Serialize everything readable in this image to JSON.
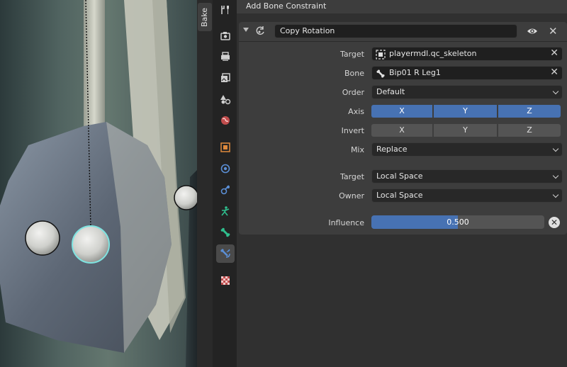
{
  "viewport": {
    "n_panel_tab": "Bake"
  },
  "properties_tabs": [
    {
      "name": "tool",
      "icon": "tool-icon"
    },
    {
      "name": "render",
      "icon": "render-icon"
    },
    {
      "name": "output",
      "icon": "output-icon"
    },
    {
      "name": "view-layer",
      "icon": "view-layer-icon"
    },
    {
      "name": "scene",
      "icon": "scene-icon"
    },
    {
      "name": "world",
      "icon": "world-icon"
    },
    {
      "name": "object",
      "icon": "object-icon"
    },
    {
      "name": "modifiers",
      "icon": "modifier-icon"
    },
    {
      "name": "physics",
      "icon": "physics-icon"
    },
    {
      "name": "object-data",
      "icon": "armature-icon"
    },
    {
      "name": "bone",
      "icon": "bone-icon"
    },
    {
      "name": "bone-constraints",
      "icon": "bone-constraint-icon",
      "active": true
    },
    {
      "name": "texture",
      "icon": "texture-icon"
    }
  ],
  "editor": {
    "add_constraint_label": "Add Bone Constraint",
    "constraint": {
      "name": "Copy Rotation",
      "visibility_icon": "eye-icon",
      "rows": {
        "target": {
          "label": "Target",
          "value": "playermdl.qc_skeleton",
          "icon": "armature-object-icon"
        },
        "bone": {
          "label": "Bone",
          "value": "Bip01 R Leg1",
          "icon": "bone-icon"
        },
        "order": {
          "label": "Order",
          "value": "Default"
        },
        "axis": {
          "label": "Axis",
          "x": "X",
          "y": "Y",
          "z": "Z",
          "x_on": true,
          "y_on": true,
          "z_on": true
        },
        "invert": {
          "label": "Invert",
          "x": "X",
          "y": "Y",
          "z": "Z",
          "x_on": false,
          "y_on": false,
          "z_on": false
        },
        "mix": {
          "label": "Mix",
          "value": "Replace"
        },
        "target_space": {
          "label": "Target",
          "value": "Local Space"
        },
        "owner_space": {
          "label": "Owner",
          "value": "Local Space"
        },
        "influence": {
          "label": "Influence",
          "value": "0.500",
          "fraction": 0.5
        }
      }
    }
  },
  "colors": {
    "accent": "#4772b3",
    "selected_outline": "#7fe3e0",
    "panel": "#3d3d3d"
  }
}
